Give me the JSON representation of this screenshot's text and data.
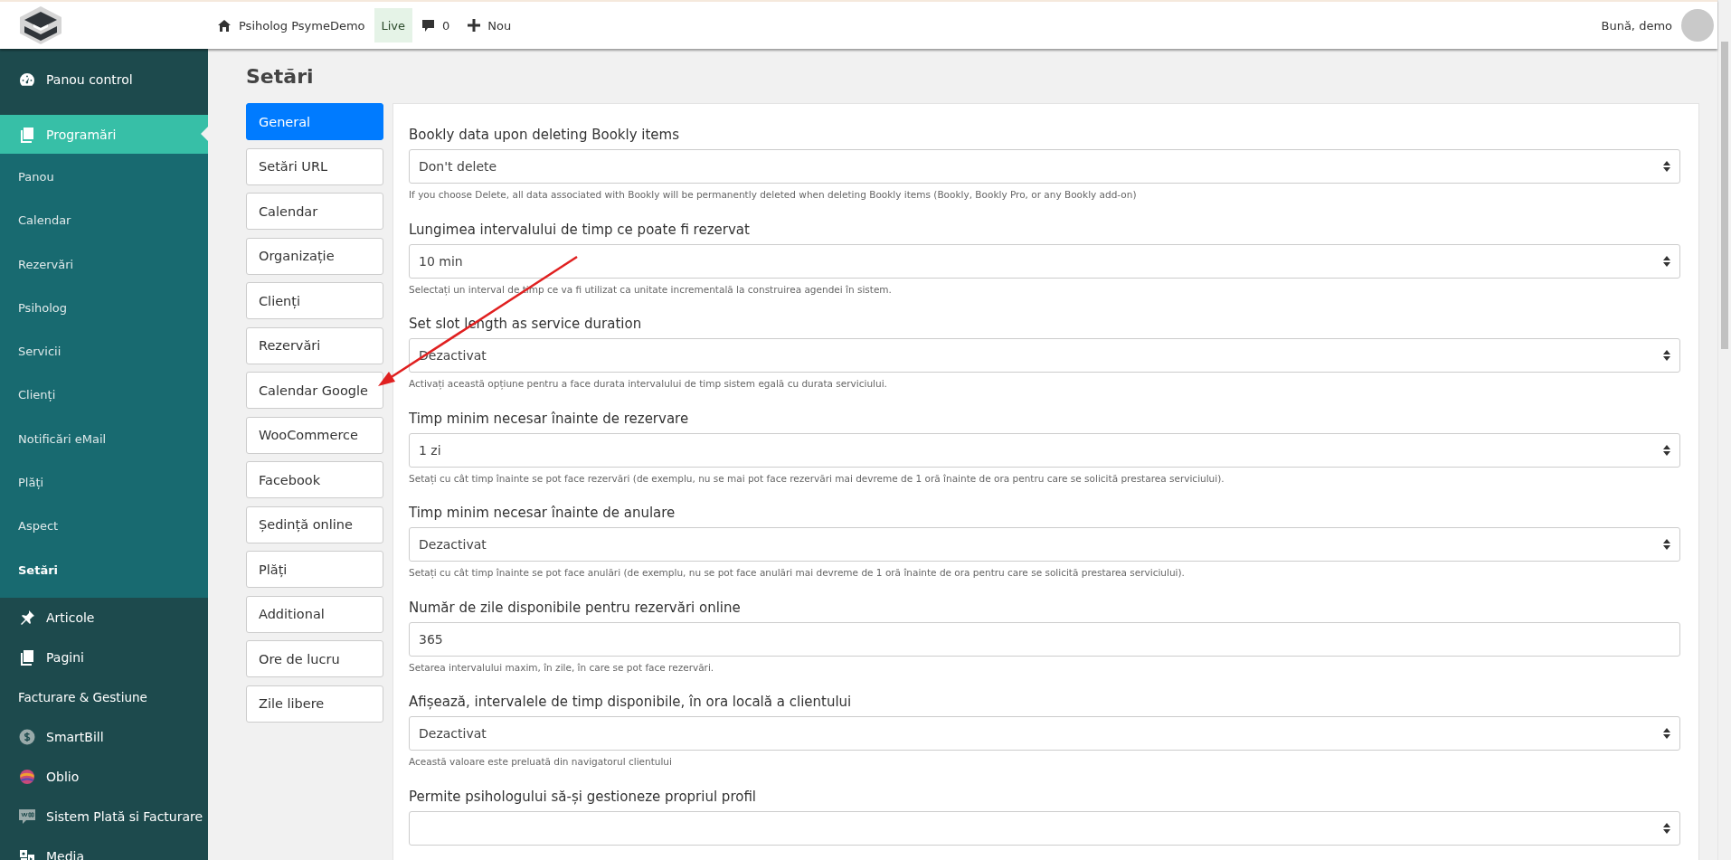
{
  "topbar": {
    "site_name": "Psiholog PsymeDemo",
    "live_badge": "Live",
    "comments_count": "0",
    "new_label": "Nou",
    "greeting": "Bună, demo"
  },
  "sidebar": {
    "items": [
      {
        "kind": "menu",
        "label": "Panou control",
        "selected": false
      },
      {
        "kind": "menu",
        "label": "Programări",
        "selected": true,
        "children": [
          {
            "label": "Panou",
            "selected": false
          },
          {
            "label": "Calendar",
            "selected": false
          },
          {
            "label": "Rezervări",
            "selected": false
          },
          {
            "label": "Psiholog",
            "selected": false
          },
          {
            "label": "Servicii",
            "selected": false
          },
          {
            "label": "Clienți",
            "selected": false
          },
          {
            "label": "Notificări eMail",
            "selected": false
          },
          {
            "label": "Plăți",
            "selected": false
          },
          {
            "label": "Aspect",
            "selected": false
          },
          {
            "label": "Setări",
            "selected": true
          }
        ]
      },
      {
        "kind": "menu",
        "label": "Articole",
        "selected": false
      },
      {
        "kind": "menu",
        "label": "Pagini",
        "selected": false
      },
      {
        "kind": "heading",
        "label": "Facturare & Gestiune",
        "selected": false
      },
      {
        "kind": "menu",
        "label": "SmartBill",
        "selected": false
      },
      {
        "kind": "menu",
        "label": "Oblio",
        "selected": false
      },
      {
        "kind": "menu",
        "label": "Sistem Plată si Facturare",
        "selected": false
      },
      {
        "kind": "menu",
        "label": "Media",
        "selected": false
      }
    ]
  },
  "page_title": "Setări",
  "settings_tabs": [
    {
      "label": "General",
      "selected": true
    },
    {
      "label": "Setări URL",
      "selected": false
    },
    {
      "label": "Calendar",
      "selected": false
    },
    {
      "label": "Organizație",
      "selected": false
    },
    {
      "label": "Clienți",
      "selected": false
    },
    {
      "label": "Rezervări",
      "selected": false
    },
    {
      "label": "Calendar Google",
      "selected": false
    },
    {
      "label": "WooCommerce",
      "selected": false
    },
    {
      "label": "Facebook",
      "selected": false
    },
    {
      "label": "Ședință online",
      "selected": false
    },
    {
      "label": "Plăți",
      "selected": false
    },
    {
      "label": "Additional",
      "selected": false
    },
    {
      "label": "Ore de lucru",
      "selected": false
    },
    {
      "label": "Zile libere",
      "selected": false
    }
  ],
  "fields": [
    {
      "kind": "select",
      "label": "Bookly data upon deleting Bookly items",
      "value": "Don't delete",
      "help": "If you choose Delete, all data associated with Bookly will be permanently deleted when deleting Bookly items (Bookly, Bookly Pro, or any Bookly add-on)"
    },
    {
      "kind": "select",
      "label": "Lungimea intervalului de timp ce poate fi rezervat",
      "value": "10 min",
      "help": "Selectați un interval de timp ce va fi utilizat ca unitate incrementală la construirea agendei în sistem."
    },
    {
      "kind": "select",
      "label": "Set slot length as service duration",
      "value": "Dezactivat",
      "help": "Activați această opțiune pentru a face durata intervalului de timp sistem egală cu durata serviciului."
    },
    {
      "kind": "select",
      "label": "Timp minim necesar înainte de rezervare",
      "value": "1 zi",
      "help": "Setați cu cât timp înainte se pot face rezervări (de exemplu, nu se mai pot face rezervări mai devreme de 1 oră înainte de ora pentru care se solicită prestarea serviciului)."
    },
    {
      "kind": "select",
      "label": "Timp minim necesar înainte de anulare",
      "value": "Dezactivat",
      "help": "Setați cu cât timp înainte se pot face anulări (de exemplu, nu se pot face anulări mai devreme de 1 oră înainte de ora pentru care se solicită prestarea serviciului)."
    },
    {
      "kind": "text",
      "label": "Număr de zile disponibile pentru rezervări online",
      "value": "365",
      "help": "Setarea intervalului maxim, în zile, în care se pot face rezervări."
    },
    {
      "kind": "select",
      "label": "Afișează, intervalele de timp disponibile, în ora locală a clientului",
      "value": "Dezactivat",
      "help": "Această valoare este preluată din navigatorul clientului"
    },
    {
      "kind": "select",
      "label": "Permite psihologului să-și gestioneze propriul profil"
    }
  ]
}
